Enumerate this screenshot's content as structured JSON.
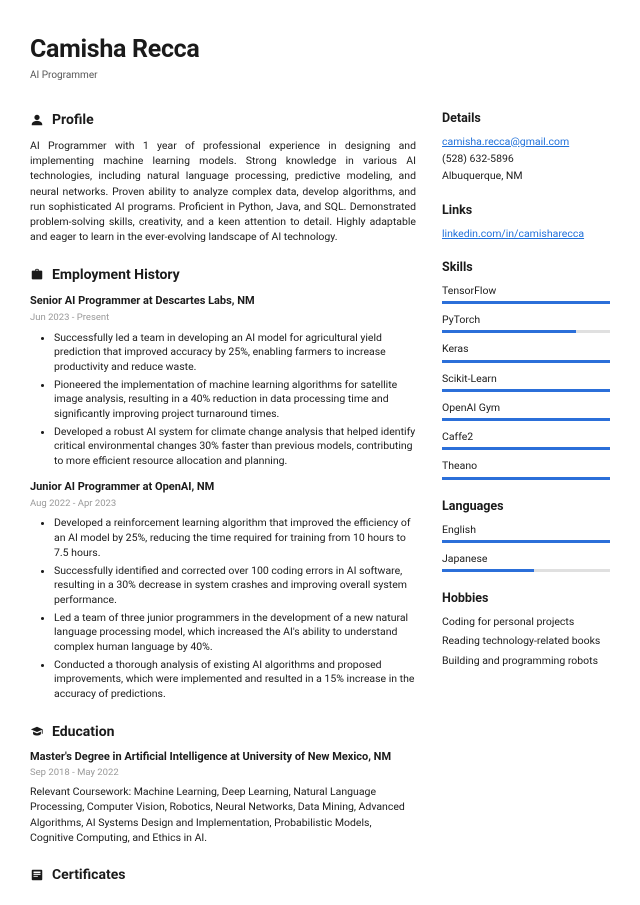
{
  "header": {
    "name": "Camisha Recca",
    "title": "AI Programmer"
  },
  "profile": {
    "heading": "Profile",
    "text": "AI Programmer with 1 year of professional experience in designing and implementing machine learning models. Strong knowledge in various AI technologies, including natural language processing, predictive modeling, and neural networks. Proven ability to analyze complex data, develop algorithms, and run sophisticated AI programs. Proficient in Python, Java, and SQL. Demonstrated problem-solving skills, creativity, and a keen attention to detail. Highly adaptable and eager to learn in the ever-evolving landscape of AI technology."
  },
  "employment": {
    "heading": "Employment History",
    "jobs": [
      {
        "title": "Senior AI Programmer at Descartes Labs, NM",
        "dates": "Jun 2023 - Present",
        "bullets": [
          "Successfully led a team in developing an AI model for agricultural yield prediction that improved accuracy by 25%, enabling farmers to increase productivity and reduce waste.",
          "Pioneered the implementation of machine learning algorithms for satellite image analysis, resulting in a 40% reduction in data processing time and significantly improving project turnaround times.",
          "Developed a robust AI system for climate change analysis that helped identify critical environmental changes 30% faster than previous models, contributing to more efficient resource allocation and planning."
        ]
      },
      {
        "title": "Junior AI Programmer at OpenAI, NM",
        "dates": "Aug 2022 - Apr 2023",
        "bullets": [
          "Developed a reinforcement learning algorithm that improved the efficiency of an AI model by 25%, reducing the time required for training from 10 hours to 7.5 hours.",
          "Successfully identified and corrected over 100 coding errors in AI software, resulting in a 30% decrease in system crashes and improving overall system performance.",
          "Led a team of three junior programmers in the development of a new natural language processing model, which increased the AI's ability to understand complex human language by 40%.",
          "Conducted a thorough analysis of existing AI algorithms and proposed improvements, which were implemented and resulted in a 15% increase in the accuracy of predictions."
        ]
      }
    ]
  },
  "education": {
    "heading": "Education",
    "title": "Master's Degree in Artificial Intelligence at University of New Mexico, NM",
    "dates": "Sep 2018 - May 2022",
    "desc": "Relevant Coursework: Machine Learning, Deep Learning, Natural Language Processing, Computer Vision, Robotics, Neural Networks, Data Mining, Advanced Algorithms, AI Systems Design and Implementation, Probabilistic Models, Cognitive Computing, and Ethics in AI."
  },
  "certificates": {
    "heading": "Certificates"
  },
  "details": {
    "heading": "Details",
    "email": "camisha.recca@gmail.com",
    "phone": "(528) 632-5896",
    "location": "Albuquerque, NM"
  },
  "links": {
    "heading": "Links",
    "url": "linkedin.com/in/camisharecca"
  },
  "skills": {
    "heading": "Skills",
    "items": [
      {
        "name": "TensorFlow",
        "level": 100
      },
      {
        "name": "PyTorch",
        "level": 80
      },
      {
        "name": "Keras",
        "level": 100
      },
      {
        "name": "Scikit-Learn",
        "level": 100
      },
      {
        "name": "OpenAI Gym",
        "level": 100
      },
      {
        "name": "Caffe2",
        "level": 100
      },
      {
        "name": "Theano",
        "level": 100
      }
    ]
  },
  "languages": {
    "heading": "Languages",
    "items": [
      {
        "name": "English",
        "level": 100
      },
      {
        "name": "Japanese",
        "level": 55
      }
    ]
  },
  "hobbies": {
    "heading": "Hobbies",
    "items": [
      "Coding for personal projects",
      "Reading technology-related books",
      "Building and programming robots"
    ]
  }
}
